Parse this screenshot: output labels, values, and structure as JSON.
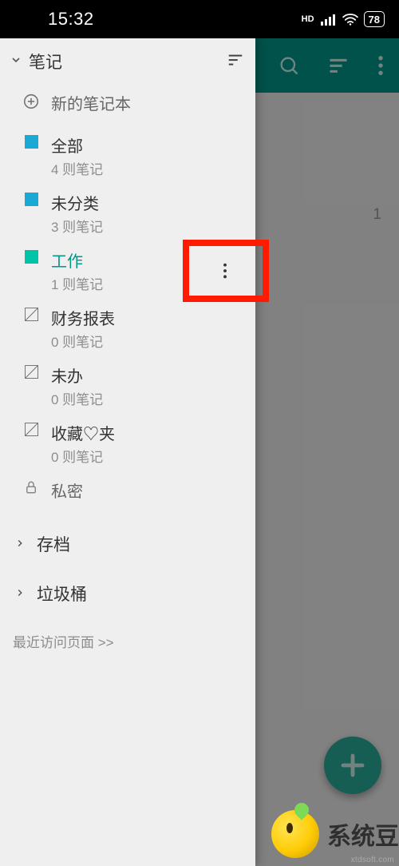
{
  "status": {
    "time": "15:32",
    "hd_indicator": "HD",
    "battery": "78"
  },
  "app": {
    "page_count": "1"
  },
  "drawer": {
    "notes_section_title": "笔记",
    "new_notebook_label": "新的笔记本",
    "notebooks": {
      "all": {
        "name": "全部",
        "count": "4 则笔记"
      },
      "uncat": {
        "name": "未分类",
        "count": "3 则笔记"
      },
      "work": {
        "name": "工作",
        "count": "1 则笔记"
      },
      "fin": {
        "name": "财务报表",
        "count": "0 则笔记"
      },
      "todo": {
        "name": "未办",
        "count": "0 则笔记"
      },
      "fav": {
        "name": "收藏♡夹",
        "count": "0 则笔记"
      }
    },
    "private_label": "私密",
    "archive_label": "存档",
    "trash_label": "垃圾桶",
    "recent_label": "最近访问页面 >>"
  },
  "watermark": {
    "text": "系统豆",
    "url": "xtdsoft.com"
  }
}
